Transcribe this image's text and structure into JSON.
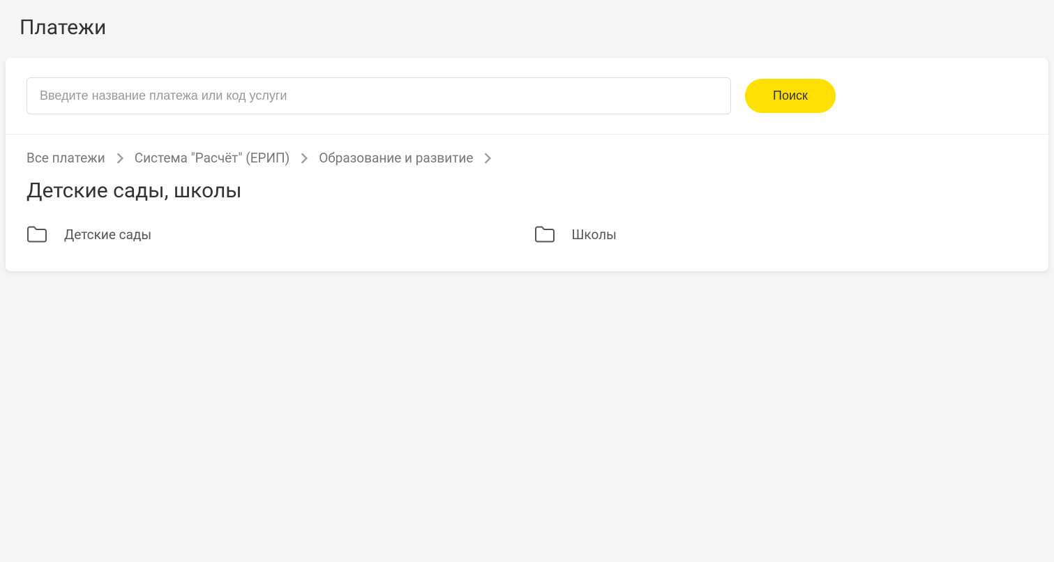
{
  "header": {
    "title": "Платежи"
  },
  "search": {
    "placeholder": "Введите название платежа или код услуги",
    "button_label": "Поиск"
  },
  "breadcrumb": {
    "items": [
      {
        "label": "Все платежи"
      },
      {
        "label": "Система \"Расчёт\" (ЕРИП)"
      },
      {
        "label": "Образование и развитие"
      }
    ]
  },
  "category": {
    "title": "Детские сады, школы",
    "items": [
      {
        "label": "Детские сады"
      },
      {
        "label": "Школы"
      }
    ]
  }
}
